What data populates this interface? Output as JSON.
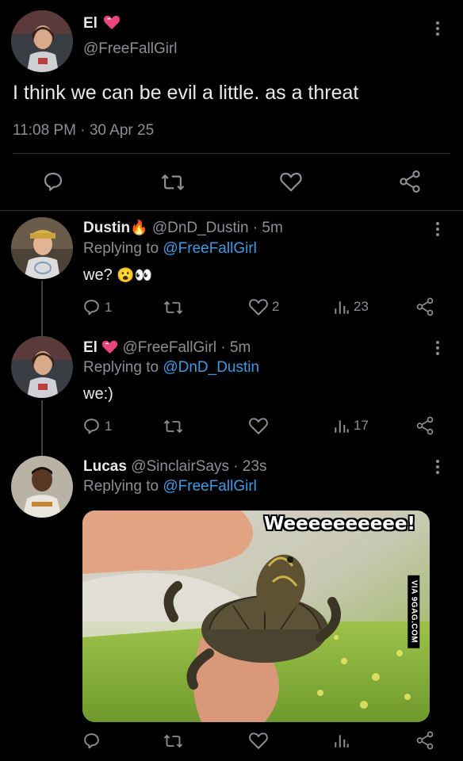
{
  "main_tweet": {
    "name": "El",
    "handle": "@FreeFallGirl",
    "text": "I think we can be evil a little. as a threat",
    "time": "11:08 PM",
    "date": "30 Apr 25"
  },
  "replies": [
    {
      "name": "Dustin",
      "emoji": "🔥",
      "handle": "@DnD_Dustin",
      "age": "5m",
      "replying_label": "Replying to",
      "replying_to": "@FreeFallGirl",
      "text": "we?",
      "text_emoji": "😮👀",
      "replies": "1",
      "likes": "2",
      "views": "23"
    },
    {
      "name": "El",
      "handle": "@FreeFallGirl",
      "age": "5m",
      "replying_label": "Replying to",
      "replying_to": "@DnD_Dustin",
      "text": "we:)",
      "replies": "1",
      "views": "17"
    },
    {
      "name": "Lucas",
      "handle": "@SinclairSays",
      "age": "23s",
      "replying_label": "Replying to",
      "replying_to": "@FreeFallGirl",
      "image_caption": "Weeeeeeeeee!",
      "image_watermark": "VIA 9GAG.COM"
    }
  ],
  "colors": {
    "background": "#000000",
    "text": "#e7e9ea",
    "secondary": "#8b9096",
    "link": "#3a9be8",
    "heart": "#e8457b"
  },
  "icons": [
    "heart-emoji-icon",
    "reply-icon",
    "retweet-icon",
    "like-icon",
    "share-icon",
    "views-icon",
    "more-icon"
  ]
}
